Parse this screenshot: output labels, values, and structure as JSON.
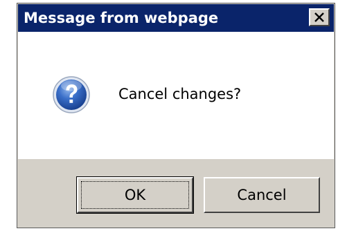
{
  "dialog": {
    "title": "Message from webpage",
    "close_icon": "close-x-icon",
    "message": "Cancel changes?",
    "message_icon": "question-icon",
    "buttons": {
      "ok_label": "OK",
      "cancel_label": "Cancel"
    },
    "focused_button": "OK"
  },
  "colors": {
    "titlebar": "#0a246a",
    "title_text": "#ffffff",
    "dialog_face": "#d4d0c8",
    "content_background": "#ffffff",
    "icon_blue": "#2a5fb8"
  }
}
